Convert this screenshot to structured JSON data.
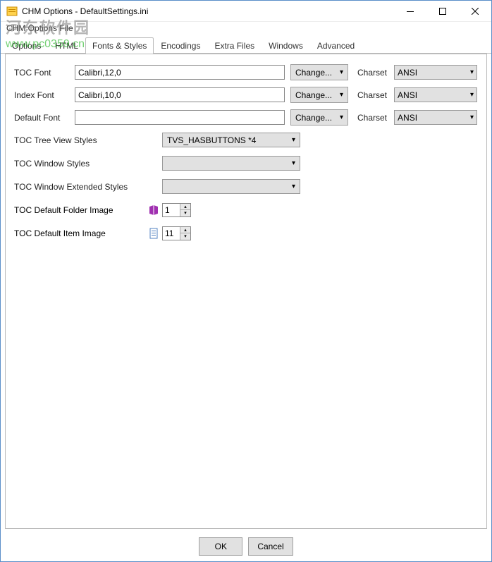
{
  "window": {
    "title": "CHM Options  - DefaultSettings.ini"
  },
  "watermark": {
    "cn": "河东软件园",
    "url": "www.pc0359.cn"
  },
  "menubar": {
    "file": "CHM Options File"
  },
  "tabs": {
    "options": "Options",
    "html": "HTML",
    "fonts": "Fonts & Styles",
    "encodings": "Encodings",
    "extra": "Extra Files",
    "windows": "Windows",
    "advanced": "Advanced"
  },
  "labels": {
    "toc_font": "TOC Font",
    "index_font": "Index Font",
    "default_font": "Default Font",
    "change": "Change...",
    "charset": "Charset",
    "toc_tree_styles": "TOC Tree View Styles",
    "toc_window_styles": "TOC Window Styles",
    "toc_window_ext_styles": "TOC Window Extended Styles",
    "toc_folder_img": "TOC Default Folder Image",
    "toc_item_img": "TOC Default Item Image"
  },
  "values": {
    "toc_font": "Calibri,12,0",
    "index_font": "Calibri,10,0",
    "default_font": "",
    "charset": "ANSI",
    "tree_styles": "TVS_HASBUTTONS *4",
    "window_styles": "",
    "window_ext_styles": "",
    "folder_img": "1",
    "item_img": "11"
  },
  "buttons": {
    "ok": "OK",
    "cancel": "Cancel"
  }
}
